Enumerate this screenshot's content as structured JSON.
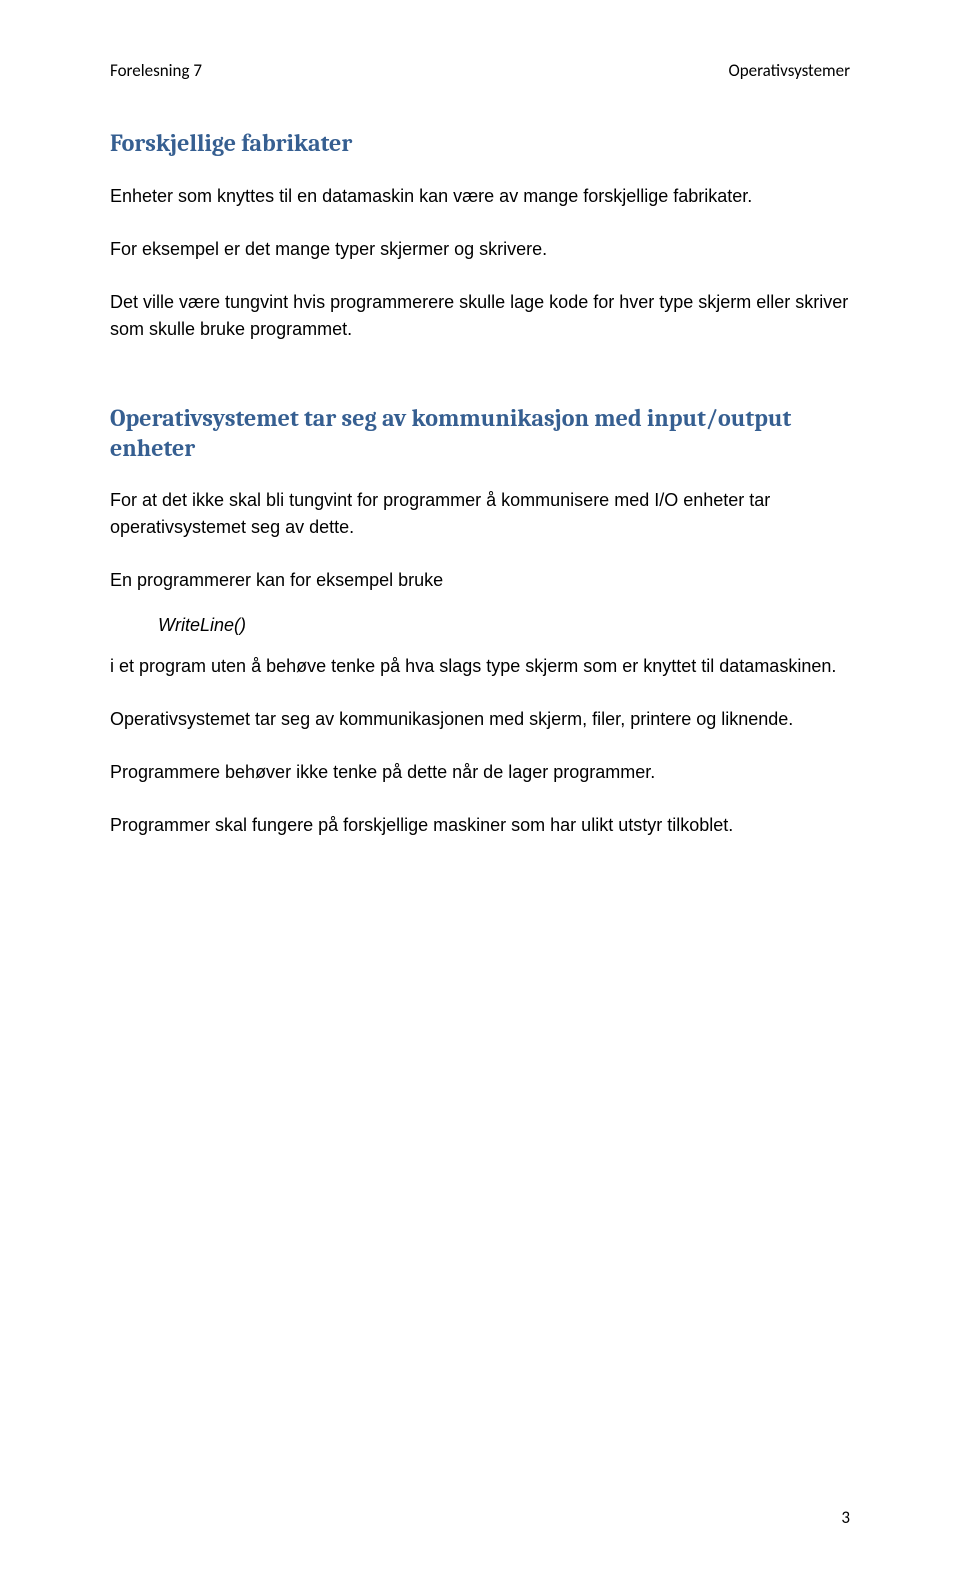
{
  "header": {
    "left": "Forelesning 7",
    "right": "Operativsystemer"
  },
  "section1": {
    "title": "Forskjellige fabrikater",
    "p1": "Enheter som knyttes til en datamaskin kan være av mange forskjellige fabrikater.",
    "p2": "For eksempel er det mange typer skjermer og skrivere.",
    "p3": "Det ville være tungvint hvis programmerere skulle lage kode for hver type skjerm eller skriver som skulle bruke programmet."
  },
  "section2": {
    "title": "Operativsystemet tar seg av kommunikasjon med input/output enheter",
    "p1": "For at det ikke skal bli tungvint for programmer å kommunisere med I/O enheter tar operativsystemet seg av dette.",
    "p2": "En programmerer kan for eksempel bruke",
    "code": "WriteLine()",
    "p3": "i et program uten å behøve tenke på hva slags type skjerm som er knyttet til datamaskinen.",
    "p4": "Operativsystemet tar seg av kommunikasjonen med skjerm, filer, printere og liknende.",
    "p5": "Programmere behøver ikke tenke på dette når de lager programmer.",
    "p6": "Programmer skal fungere på forskjellige maskiner som har ulikt utstyr tilkoblet."
  },
  "pageNumber": "3"
}
